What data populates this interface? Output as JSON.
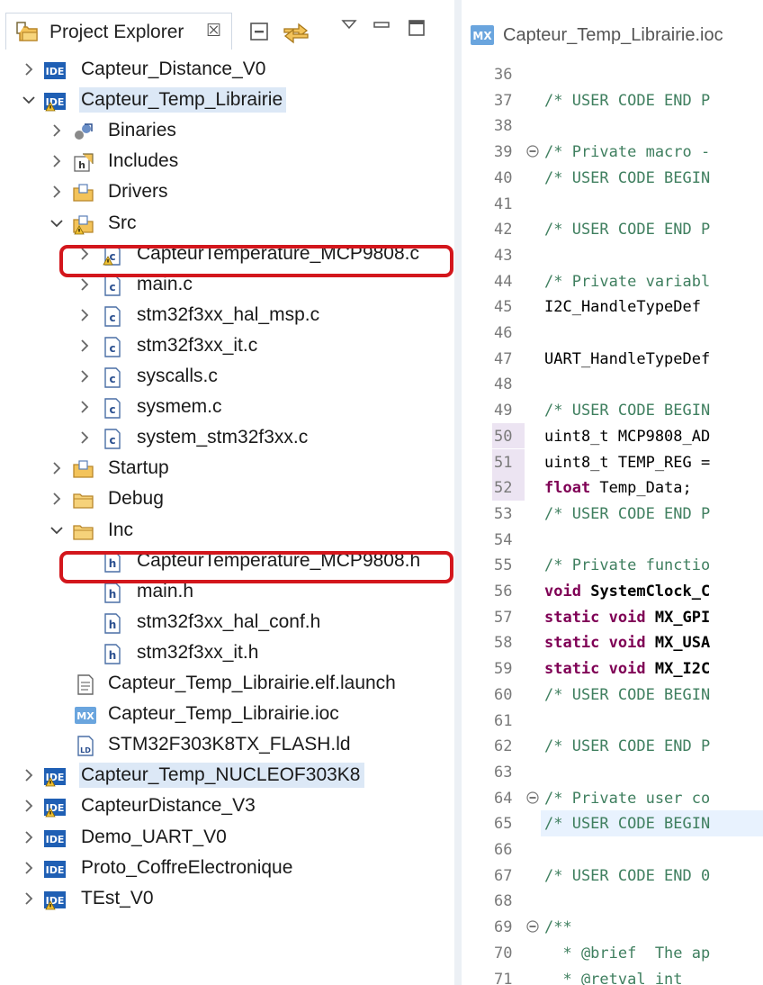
{
  "explorer": {
    "tab_title": "Project Explorer",
    "toolbar": [
      "collapse-all-icon",
      "link-with-editor-icon",
      "view-menu-icon",
      "minimize-icon",
      "maximize-icon"
    ]
  },
  "tree": [
    {
      "label": "Capteur_Distance_V0",
      "icon": "ide-project-icon",
      "indent": 0,
      "expander": "collapsed"
    },
    {
      "label": "Capteur_Temp_Librairie",
      "icon": "ide-project-warning-icon",
      "indent": 0,
      "expander": "expanded",
      "selected": true
    },
    {
      "label": "Binaries",
      "icon": "binaries-icon",
      "indent": 1,
      "expander": "collapsed"
    },
    {
      "label": "Includes",
      "icon": "includes-icon",
      "indent": 1,
      "expander": "collapsed"
    },
    {
      "label": "Drivers",
      "icon": "source-folder-icon",
      "indent": 1,
      "expander": "collapsed"
    },
    {
      "label": "Src",
      "icon": "source-folder-warning-icon",
      "indent": 1,
      "expander": "expanded"
    },
    {
      "label": "CapteurTemperature_MCP9808.c",
      "icon": "c-file-warning-icon",
      "indent": 2,
      "expander": "collapsed",
      "highlighted": true
    },
    {
      "label": "main.c",
      "icon": "c-file-icon",
      "indent": 2,
      "expander": "collapsed"
    },
    {
      "label": "stm32f3xx_hal_msp.c",
      "icon": "c-file-icon",
      "indent": 2,
      "expander": "collapsed"
    },
    {
      "label": "stm32f3xx_it.c",
      "icon": "c-file-icon",
      "indent": 2,
      "expander": "collapsed"
    },
    {
      "label": "syscalls.c",
      "icon": "c-file-icon",
      "indent": 2,
      "expander": "collapsed"
    },
    {
      "label": "sysmem.c",
      "icon": "c-file-icon",
      "indent": 2,
      "expander": "collapsed"
    },
    {
      "label": "system_stm32f3xx.c",
      "icon": "c-file-icon",
      "indent": 2,
      "expander": "collapsed"
    },
    {
      "label": "Startup",
      "icon": "source-folder-icon",
      "indent": 1,
      "expander": "collapsed"
    },
    {
      "label": "Debug",
      "icon": "folder-icon",
      "indent": 1,
      "expander": "collapsed"
    },
    {
      "label": "Inc",
      "icon": "folder-icon",
      "indent": 1,
      "expander": "expanded"
    },
    {
      "label": "CapteurTemperature_MCP9808.h",
      "icon": "h-file-icon",
      "indent": 2,
      "expander": "none",
      "highlighted": true
    },
    {
      "label": "main.h",
      "icon": "h-file-icon",
      "indent": 2,
      "expander": "none"
    },
    {
      "label": "stm32f3xx_hal_conf.h",
      "icon": "h-file-icon",
      "indent": 2,
      "expander": "none"
    },
    {
      "label": "stm32f3xx_it.h",
      "icon": "h-file-icon",
      "indent": 2,
      "expander": "none"
    },
    {
      "label": "Capteur_Temp_Librairie.elf.launch",
      "icon": "text-file-icon",
      "indent": 1,
      "expander": "none"
    },
    {
      "label": "Capteur_Temp_Librairie.ioc",
      "icon": "mx-file-icon",
      "indent": 1,
      "expander": "none"
    },
    {
      "label": "STM32F303K8TX_FLASH.ld",
      "icon": "ld-file-icon",
      "indent": 1,
      "expander": "none"
    },
    {
      "label": "Capteur_Temp_NUCLEOF303K8",
      "icon": "ide-project-warning-icon",
      "indent": 0,
      "expander": "collapsed",
      "selected": true
    },
    {
      "label": "CapteurDistance_V3",
      "icon": "ide-project-warning-icon",
      "indent": 0,
      "expander": "collapsed"
    },
    {
      "label": "Demo_UART_V0",
      "icon": "ide-project-icon",
      "indent": 0,
      "expander": "collapsed"
    },
    {
      "label": "Proto_CoffreElectronique",
      "icon": "ide-project-icon",
      "indent": 0,
      "expander": "collapsed"
    },
    {
      "label": "TEst_V0",
      "icon": "ide-project-warning-icon",
      "indent": 0,
      "expander": "collapsed"
    }
  ],
  "editor": {
    "tab_title": "Capteur_Temp_Librairie.ioc",
    "tab_icon": "mx-file-icon",
    "lines": [
      {
        "n": "36",
        "parts": []
      },
      {
        "n": "37",
        "parts": [
          {
            "t": "/* USER CODE END P",
            "c": "comment"
          }
        ]
      },
      {
        "n": "38",
        "parts": []
      },
      {
        "n": "39",
        "fold": true,
        "parts": [
          {
            "t": "/* Private macro -",
            "c": "comment"
          }
        ]
      },
      {
        "n": "40",
        "parts": [
          {
            "t": "/* USER CODE BEGIN",
            "c": "comment"
          }
        ]
      },
      {
        "n": "41",
        "parts": []
      },
      {
        "n": "42",
        "parts": [
          {
            "t": "/* USER CODE END P",
            "c": "comment"
          }
        ]
      },
      {
        "n": "43",
        "parts": []
      },
      {
        "n": "44",
        "parts": [
          {
            "t": "/* Private variabl",
            "c": "comment"
          }
        ]
      },
      {
        "n": "45",
        "parts": [
          {
            "t": "I2C_HandleTypeDef",
            "c": "plain"
          }
        ]
      },
      {
        "n": "46",
        "parts": []
      },
      {
        "n": "47",
        "parts": [
          {
            "t": "UART_HandleTypeDef",
            "c": "plain"
          }
        ]
      },
      {
        "n": "48",
        "parts": []
      },
      {
        "n": "49",
        "parts": [
          {
            "t": "/* USER CODE BEGIN",
            "c": "comment"
          }
        ]
      },
      {
        "n": "50",
        "mark": true,
        "parts": [
          {
            "t": "uint8_t MCP9808_AD",
            "c": "plain"
          }
        ]
      },
      {
        "n": "51",
        "mark": true,
        "parts": [
          {
            "t": "uint8_t TEMP_REG =",
            "c": "plain"
          }
        ]
      },
      {
        "n": "52",
        "mark": true,
        "parts": [
          {
            "t": "float",
            "c": "kw"
          },
          {
            "t": " Temp_Data;",
            "c": "plain"
          }
        ]
      },
      {
        "n": "53",
        "parts": [
          {
            "t": "/* USER CODE END P",
            "c": "comment"
          }
        ]
      },
      {
        "n": "54",
        "parts": []
      },
      {
        "n": "55",
        "parts": [
          {
            "t": "/* Private functio",
            "c": "comment"
          }
        ]
      },
      {
        "n": "56",
        "parts": [
          {
            "t": "void",
            "c": "kw"
          },
          {
            "t": " ",
            "c": "plain"
          },
          {
            "t": "SystemClock_C",
            "c": "bold"
          }
        ]
      },
      {
        "n": "57",
        "parts": [
          {
            "t": "static void",
            "c": "kw"
          },
          {
            "t": " ",
            "c": "plain"
          },
          {
            "t": "MX_GPI",
            "c": "bold"
          }
        ]
      },
      {
        "n": "58",
        "parts": [
          {
            "t": "static void",
            "c": "kw"
          },
          {
            "t": " ",
            "c": "plain"
          },
          {
            "t": "MX_USA",
            "c": "bold"
          }
        ]
      },
      {
        "n": "59",
        "parts": [
          {
            "t": "static void",
            "c": "kw"
          },
          {
            "t": " ",
            "c": "plain"
          },
          {
            "t": "MX_I2C",
            "c": "bold"
          }
        ]
      },
      {
        "n": "60",
        "parts": [
          {
            "t": "/* USER CODE BEGIN",
            "c": "comment"
          }
        ]
      },
      {
        "n": "61",
        "parts": []
      },
      {
        "n": "62",
        "parts": [
          {
            "t": "/* USER CODE END P",
            "c": "comment"
          }
        ]
      },
      {
        "n": "63",
        "parts": []
      },
      {
        "n": "64",
        "fold": true,
        "parts": [
          {
            "t": "/* Private user co",
            "c": "comment"
          }
        ]
      },
      {
        "n": "65",
        "current": true,
        "parts": [
          {
            "t": "/* USER CODE BEGIN",
            "c": "comment"
          }
        ]
      },
      {
        "n": "66",
        "parts": []
      },
      {
        "n": "67",
        "parts": [
          {
            "t": "/* USER CODE END 0",
            "c": "comment"
          }
        ]
      },
      {
        "n": "68",
        "parts": []
      },
      {
        "n": "69",
        "fold": true,
        "parts": [
          {
            "t": "/**",
            "c": "comment"
          }
        ]
      },
      {
        "n": "70",
        "parts": [
          {
            "t": "  * @brief  The ap",
            "c": "comment"
          }
        ]
      },
      {
        "n": "71",
        "parts": [
          {
            "t": "  * @retval int",
            "c": "comment"
          }
        ]
      }
    ]
  },
  "colors": {
    "highlight_border": "#d3161c",
    "selection_bg": "#dce8f6",
    "comment": "#3f7f5f",
    "keyword": "#7f0055",
    "ide_blue": "#1f5fb4"
  }
}
